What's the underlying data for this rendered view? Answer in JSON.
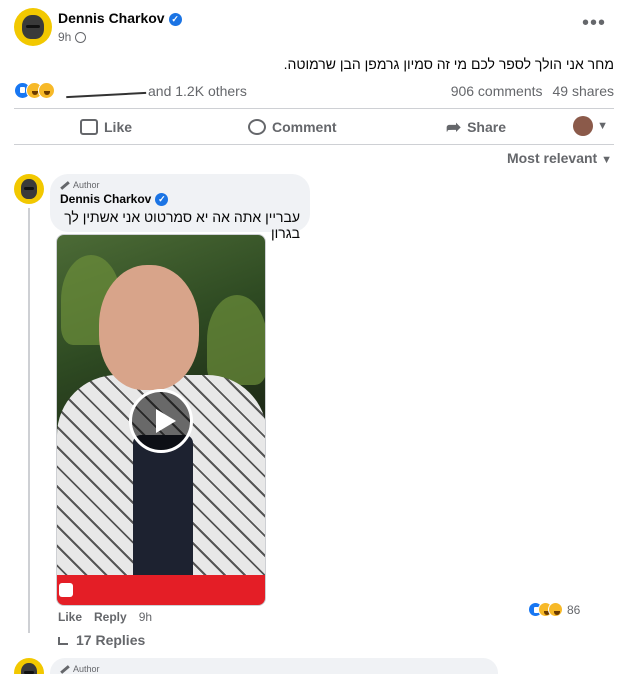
{
  "post": {
    "author": "Dennis Charkov",
    "time": "9h",
    "text": "מחר אני הולך לספר לכם מי זה סמיון גרמפן הבן שרמוטה.",
    "reactions_others": "and 1.2K others",
    "comments_count": "906 comments",
    "shares_count": "49 shares",
    "actions": {
      "like": "Like",
      "comment": "Comment",
      "share": "Share"
    },
    "sort_label": "Most relevant"
  },
  "comment": {
    "author_tag": "Author",
    "author": "Dennis Charkov",
    "text": "עבריין אתה אה יא סמרטוט אני אשתין לך בגרון",
    "like_label": "Like",
    "reply_label": "Reply",
    "time": "9h",
    "reaction_count": "86",
    "replies_label": "17 Replies"
  },
  "next_comment": {
    "author_tag": "Author"
  },
  "colors": {
    "accent": "#1877f2",
    "muted": "#65676b",
    "bubble": "#f0f2f5",
    "video_bar": "#e41e26"
  },
  "icons": [
    "verified-icon",
    "globe-icon",
    "more-icon",
    "like-icon",
    "comment-icon",
    "share-icon",
    "play-icon",
    "pen-icon",
    "reply-arrow-icon"
  ]
}
